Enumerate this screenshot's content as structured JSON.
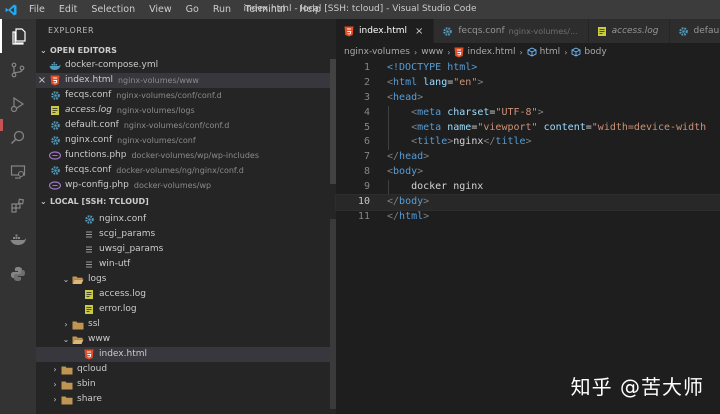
{
  "titlebar": {
    "menu": [
      "File",
      "Edit",
      "Selection",
      "View",
      "Go",
      "Run",
      "Terminal",
      "Help"
    ],
    "window_title": "index.html - local [SSH: tcloud] - Visual Studio Code"
  },
  "activity_icons": [
    "explorer-icon",
    "source-control-icon",
    "run-debug-icon",
    "search-icon",
    "remote-explorer-icon",
    "extensions-icon",
    "docker-icon",
    "python-icon"
  ],
  "sidebar": {
    "title": "EXPLORER",
    "open_editors_header": "OPEN EDITORS",
    "open_editors": [
      {
        "icon": "docker-file-icon",
        "name": "docker-compose.yml",
        "desc": "",
        "italic": false,
        "close": false
      },
      {
        "icon": "html-file-icon",
        "name": "index.html",
        "desc": "nginx-volumes/www",
        "italic": false,
        "close": true
      },
      {
        "icon": "gear-file-icon",
        "name": "fecqs.conf",
        "desc": "nginx-volumes/conf/conf.d",
        "italic": false,
        "close": false
      },
      {
        "icon": "log-file-icon",
        "name": "access.log",
        "desc": "nginx-volumes/logs",
        "italic": true,
        "close": false
      },
      {
        "icon": "gear-file-icon",
        "name": "default.conf",
        "desc": "nginx-volumes/conf/conf.d",
        "italic": false,
        "close": false
      },
      {
        "icon": "gear-file-icon",
        "name": "nginx.conf",
        "desc": "nginx-volumes/conf",
        "italic": false,
        "close": false
      },
      {
        "icon": "php-file-icon",
        "name": "functions.php",
        "desc": "docker-volumes/wp/wp-includes",
        "italic": false,
        "close": false
      },
      {
        "icon": "gear-file-icon",
        "name": "fecqs.conf",
        "desc": "docker-volumes/ng/nginx/conf.d",
        "italic": false,
        "close": false
      },
      {
        "icon": "php-file-icon",
        "name": "wp-config.php",
        "desc": "docker-volumes/wp",
        "italic": false,
        "close": false
      }
    ],
    "folder_header": "LOCAL [SSH: TCLOUD]",
    "tree": [
      {
        "indent": 1,
        "twisty": "",
        "icon": "gear-file-icon",
        "name": "nginx.conf"
      },
      {
        "indent": 1,
        "twisty": "",
        "icon": "generic-file-icon",
        "name": "scgi_params"
      },
      {
        "indent": 1,
        "twisty": "",
        "icon": "generic-file-icon",
        "name": "uwsgi_params"
      },
      {
        "indent": 1,
        "twisty": "",
        "icon": "generic-file-icon",
        "name": "win-utf"
      },
      {
        "indent": 0,
        "twisty": "⌄",
        "icon": "folder-open-icon",
        "name": "logs"
      },
      {
        "indent": 1,
        "twisty": "",
        "icon": "log-file-icon",
        "name": "access.log"
      },
      {
        "indent": 1,
        "twisty": "",
        "icon": "log-file-icon",
        "name": "error.log"
      },
      {
        "indent": 0,
        "twisty": "›",
        "icon": "folder-icon",
        "name": "ssl"
      },
      {
        "indent": 0,
        "twisty": "⌄",
        "icon": "folder-open-icon",
        "name": "www"
      },
      {
        "indent": 1,
        "twisty": "",
        "icon": "html-file-icon",
        "name": "index.html",
        "selected": true
      },
      {
        "indent": -1,
        "twisty": "›",
        "icon": "folder-icon",
        "name": "qcloud"
      },
      {
        "indent": -1,
        "twisty": "›",
        "icon": "folder-icon",
        "name": "sbin"
      },
      {
        "indent": -1,
        "twisty": "›",
        "icon": "folder-icon",
        "name": "share"
      }
    ]
  },
  "tabs": [
    {
      "icon": "html-file-icon",
      "name": "index.html",
      "desc": "",
      "active": true,
      "italic": false
    },
    {
      "icon": "gear-file-icon",
      "name": "fecqs.conf",
      "desc": "nginx-volumes/...",
      "active": false,
      "italic": false
    },
    {
      "icon": "log-file-icon",
      "name": "access.log",
      "desc": "",
      "active": false,
      "italic": true
    },
    {
      "icon": "gear-file-icon",
      "name": "default.conf",
      "desc": "",
      "active": false,
      "italic": false
    }
  ],
  "breadcrumb": [
    "nginx-volumes",
    "www",
    "index.html",
    "html",
    "body"
  ],
  "code_lines": [
    [
      [
        "tag",
        "<!DOCTYPE html>"
      ]
    ],
    [
      [
        "pun",
        "<"
      ],
      [
        "tag",
        "html "
      ],
      [
        "att",
        "lang"
      ],
      [
        "plain",
        "="
      ],
      [
        "str",
        "\"en\""
      ],
      [
        "pun",
        ">"
      ]
    ],
    [
      [
        "pun",
        "<"
      ],
      [
        "tag",
        "head"
      ],
      [
        "pun",
        ">"
      ]
    ],
    [
      [
        "plain",
        "    "
      ],
      [
        "pun",
        "<"
      ],
      [
        "tag",
        "meta "
      ],
      [
        "att",
        "charset"
      ],
      [
        "plain",
        "="
      ],
      [
        "str",
        "\"UTF-8\""
      ],
      [
        "pun",
        ">"
      ]
    ],
    [
      [
        "plain",
        "    "
      ],
      [
        "pun",
        "<"
      ],
      [
        "tag",
        "meta "
      ],
      [
        "att",
        "name"
      ],
      [
        "plain",
        "="
      ],
      [
        "str",
        "\"viewport\" "
      ],
      [
        "att",
        "content"
      ],
      [
        "plain",
        "="
      ],
      [
        "str",
        "\"width=device-width"
      ]
    ],
    [
      [
        "plain",
        "    "
      ],
      [
        "pun",
        "<"
      ],
      [
        "tag",
        "title"
      ],
      [
        "pun",
        ">"
      ],
      [
        "plain",
        "nginx"
      ],
      [
        "pun",
        "</"
      ],
      [
        "tag",
        "title"
      ],
      [
        "pun",
        ">"
      ]
    ],
    [
      [
        "pun",
        "</"
      ],
      [
        "tag",
        "head"
      ],
      [
        "pun",
        ">"
      ]
    ],
    [
      [
        "pun",
        "<"
      ],
      [
        "tag",
        "body"
      ],
      [
        "pun",
        ">"
      ]
    ],
    [
      [
        "plain",
        "    docker nginx"
      ]
    ],
    [
      [
        "pun",
        "</"
      ],
      [
        "tag",
        "body"
      ],
      [
        "pun",
        ">"
      ]
    ],
    [
      [
        "pun",
        "</"
      ],
      [
        "tag",
        "html"
      ],
      [
        "pun",
        ">"
      ]
    ]
  ],
  "current_line": 10,
  "watermark": "知乎 @苦大师"
}
